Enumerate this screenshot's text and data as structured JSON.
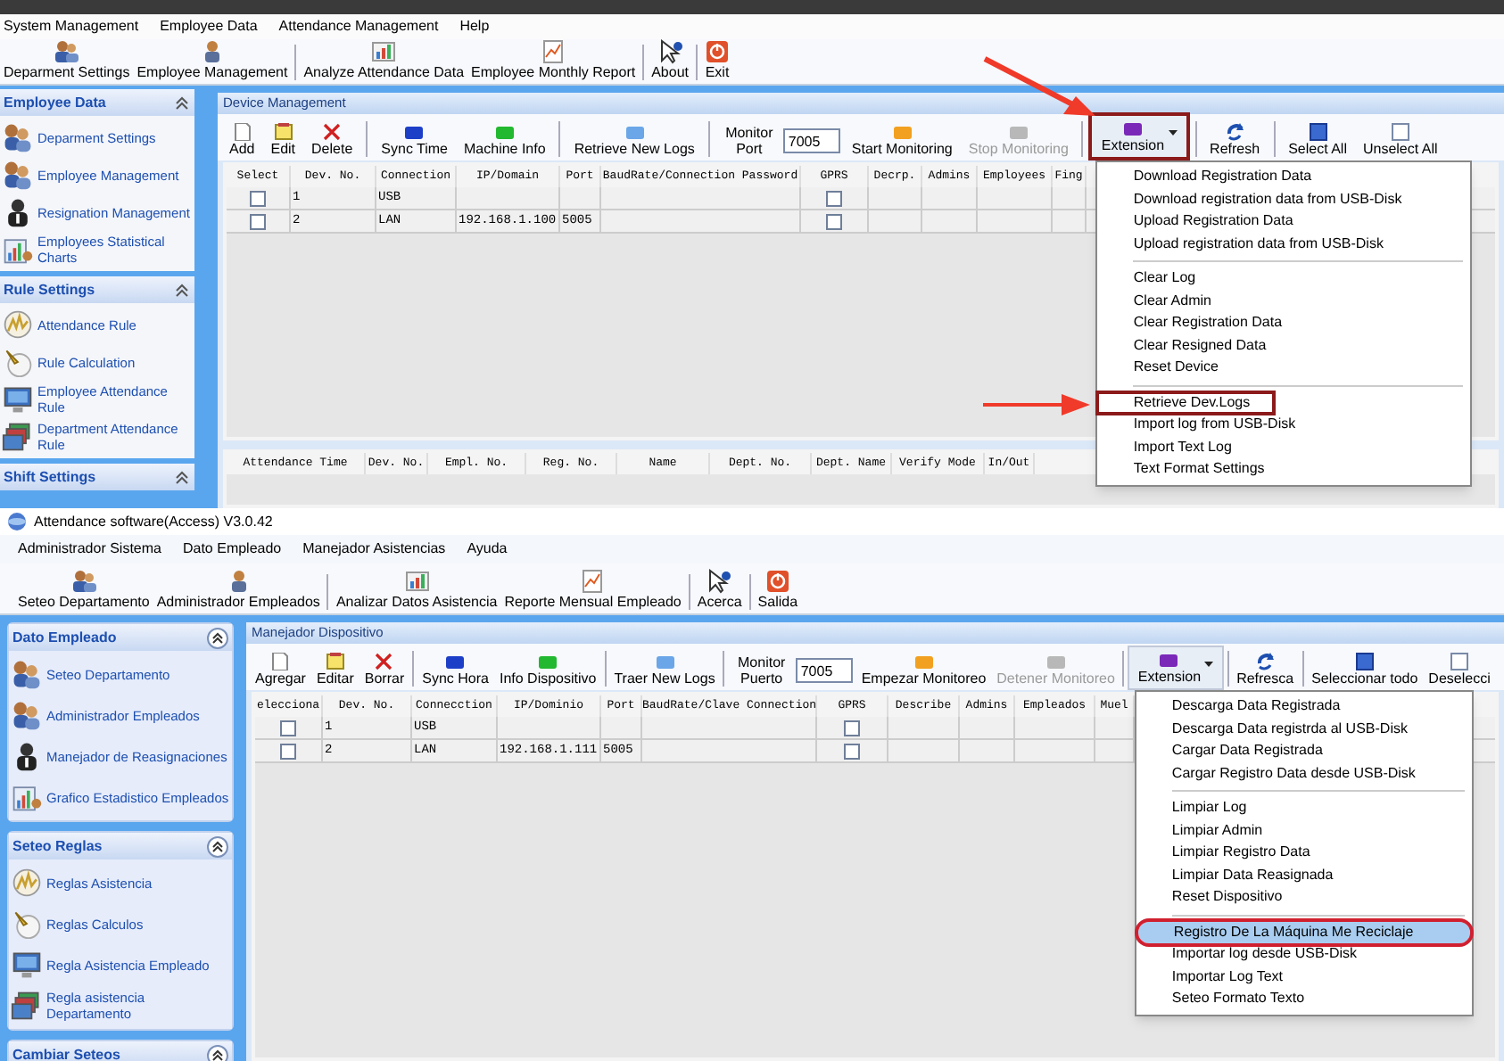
{
  "panels": [
    {
      "menubar": [
        "System Management",
        "Employee Data",
        "Attendance Management",
        "Help"
      ],
      "app_toolbar": [
        [
          "Deparment Settings",
          "Employee Management"
        ],
        [
          "Analyze Attendance Data",
          "Employee Monthly Report"
        ],
        [
          "About"
        ],
        [
          "Exit"
        ]
      ],
      "sidebar": [
        {
          "title": "Employee Data",
          "items": [
            "Deparment Settings",
            "Employee Management",
            "Resignation Management",
            "Employees Statistical Charts"
          ]
        },
        {
          "title": "Rule Settings",
          "items": [
            "Attendance Rule",
            "Rule Calculation",
            "Employee Attendance Rule",
            "Department Attendance Rule"
          ]
        },
        {
          "title": "Shift Settings"
        }
      ],
      "device": {
        "title": "Device Management",
        "toolbar": [
          [
            {
              "kind": "button",
              "label": "Add",
              "disabled": false
            },
            {
              "kind": "button",
              "label": "Edit",
              "disabled": false
            },
            {
              "kind": "button",
              "label": "Delete",
              "disabled": false
            }
          ],
          [
            {
              "kind": "button",
              "label": "Sync Time",
              "disabled": false
            },
            {
              "kind": "button",
              "label": "Machine Info",
              "disabled": false
            }
          ],
          [
            {
              "kind": "button",
              "label": "Retrieve New Logs",
              "disabled": false
            }
          ],
          [
            {
              "kind": "port",
              "label": "Monitor Port",
              "value": "7005"
            },
            {
              "kind": "button",
              "label": "Start Monitoring",
              "disabled": false
            },
            {
              "kind": "button",
              "label": "Stop Monitoring",
              "disabled": true
            }
          ],
          [
            {
              "kind": "dropdown",
              "label": "Extension",
              "outlined": true
            }
          ],
          [
            {
              "kind": "button",
              "label": "Refresh",
              "disabled": false
            }
          ],
          [
            {
              "kind": "button",
              "label": "Select All",
              "disabled": false
            },
            {
              "kind": "button",
              "label": "Unselect All",
              "disabled": false
            }
          ]
        ],
        "columns": [
          "Select",
          "Dev. No.",
          "Connection",
          "IP/Domain",
          "Port",
          "BaudRate/Connection Password",
          "GPRS",
          "Decrp.",
          "Admins",
          "Employees",
          "Fing"
        ],
        "rows": [
          {
            "selected": false,
            "dev_no": "1",
            "connection": "USB",
            "ip": "",
            "port": "",
            "gprs": false
          },
          {
            "selected": false,
            "dev_no": "2",
            "connection": "LAN",
            "ip": "192.168.1.100",
            "port": "5005",
            "gprs": false
          }
        ],
        "log_columns": [
          "Attendance Time",
          "Dev. No.",
          "Empl. No.",
          "Reg. No.",
          "Name",
          "Dept. No.",
          "Dept. Name",
          "Verify Mode",
          "In/Out"
        ],
        "menu": [
          [
            {
              "label": "Download Registration Data",
              "selected": false,
              "outlined": false
            },
            {
              "label": "Download registration data from USB-Disk",
              "selected": false,
              "outlined": false
            },
            {
              "label": "Upload Registration Data",
              "selected": false,
              "outlined": false
            },
            {
              "label": "Upload registration data from USB-Disk",
              "selected": false,
              "outlined": false
            }
          ],
          [
            {
              "label": "Clear Log",
              "selected": false,
              "outlined": false
            },
            {
              "label": "Clear Admin",
              "selected": false,
              "outlined": false
            },
            {
              "label": "Clear Registration Data",
              "selected": false,
              "outlined": false
            },
            {
              "label": "Clear Resigned Data",
              "selected": false,
              "outlined": false
            },
            {
              "label": "Reset Device",
              "selected": false,
              "outlined": false
            }
          ],
          [
            {
              "label": "Retrieve Dev.Logs",
              "selected": false,
              "outlined": true
            },
            {
              "label": "Import log from USB-Disk",
              "selected": false,
              "outlined": false
            },
            {
              "label": "Import Text Log",
              "selected": false,
              "outlined": false
            },
            {
              "label": "Text Format Settings",
              "selected": false,
              "outlined": false
            }
          ]
        ]
      }
    },
    {
      "title": "Attendance software(Access) V3.0.42",
      "menubar": [
        "Administrador Sistema",
        "Dato Empleado",
        "Manejador Asistencias",
        "Ayuda"
      ],
      "app_toolbar": [
        [
          "Seteo Departamento",
          "Administrador Empleados"
        ],
        [
          "Analizar Datos Asistencia",
          "Reporte Mensual Empleado"
        ],
        [
          "Acerca"
        ],
        [
          "Salida"
        ]
      ],
      "sidebar": [
        {
          "title": "Dato Empleado",
          "items": [
            "Seteo Departamento",
            "Administrador Empleados",
            "Manejador de Reasignaciones",
            "Grafico Estadistico Empleados"
          ]
        },
        {
          "title": "Seteo Reglas",
          "items": [
            "Reglas Asistencia",
            "Reglas Calculos",
            "Regla Asistencia Empleado",
            "Regla asistencia Departamento"
          ]
        },
        {
          "title": "Cambiar Seteos"
        }
      ],
      "device": {
        "title": "Manejador Dispositivo",
        "toolbar": [
          [
            {
              "kind": "button",
              "label": "Agregar",
              "disabled": false
            },
            {
              "kind": "button",
              "label": "Editar",
              "disabled": false
            },
            {
              "kind": "button",
              "label": "Borrar",
              "disabled": false
            }
          ],
          [
            {
              "kind": "button",
              "label": "Sync Hora",
              "disabled": false
            },
            {
              "kind": "button",
              "label": "Info Dispositivo",
              "disabled": false
            }
          ],
          [
            {
              "kind": "button",
              "label": "Traer New Logs",
              "disabled": false
            }
          ],
          [
            {
              "kind": "port",
              "label": "Monitor Puerto",
              "value": "7005"
            },
            {
              "kind": "button",
              "label": "Empezar Monitoreo",
              "disabled": false
            },
            {
              "kind": "button",
              "label": "Detener Monitoreo",
              "disabled": true
            }
          ],
          [
            {
              "kind": "dropdown",
              "label": "Extension",
              "outlined": false
            }
          ],
          [
            {
              "kind": "button",
              "label": "Refresca",
              "disabled": false
            }
          ],
          [
            {
              "kind": "button",
              "label": "Seleccionar todo",
              "disabled": false
            },
            {
              "kind": "button",
              "label": "Deselecci",
              "disabled": false
            }
          ]
        ],
        "columns": [
          "elecciona",
          "Dev. No.",
          "Connecction",
          "IP/Dominio",
          "Port",
          "BaudRate/Clave Connection",
          "GPRS",
          "Describe",
          "Admins",
          "Empleados",
          "Muel"
        ],
        "rows": [
          {
            "selected": false,
            "dev_no": "1",
            "connection": "USB",
            "ip": "",
            "port": "",
            "gprs": false
          },
          {
            "selected": false,
            "dev_no": "2",
            "connection": "LAN",
            "ip": "192.168.1.111",
            "port": "5005",
            "gprs": false
          }
        ],
        "menu": [
          [
            {
              "label": "Descarga Data Registrada",
              "selected": false,
              "outlined": false
            },
            {
              "label": "Descarga Data registrda al USB-Disk",
              "selected": false,
              "outlined": false
            },
            {
              "label": "Cargar Data Registrada",
              "selected": false,
              "outlined": false
            },
            {
              "label": "Cargar Registro Data desde USB-Disk",
              "selected": false,
              "outlined": false
            }
          ],
          [
            {
              "label": "Limpiar Log",
              "selected": false,
              "outlined": false
            },
            {
              "label": "Limpiar Admin",
              "selected": false,
              "outlined": false
            },
            {
              "label": "Limpiar Registro Data",
              "selected": false,
              "outlined": false
            },
            {
              "label": "Limpiar Data Reasignada",
              "selected": false,
              "outlined": false
            },
            {
              "label": "Reset Dispositivo",
              "selected": false,
              "outlined": false
            }
          ],
          [
            {
              "label": "Registro De La Máquina Me Reciclaje",
              "selected": true,
              "outlined": true
            },
            {
              "label": "Importar log desde USB-Disk",
              "selected": false,
              "outlined": false
            },
            {
              "label": "Importar Log Text",
              "selected": false,
              "outlined": false
            },
            {
              "label": "Seteo Formato Texto",
              "selected": false,
              "outlined": false
            }
          ]
        ]
      }
    }
  ]
}
